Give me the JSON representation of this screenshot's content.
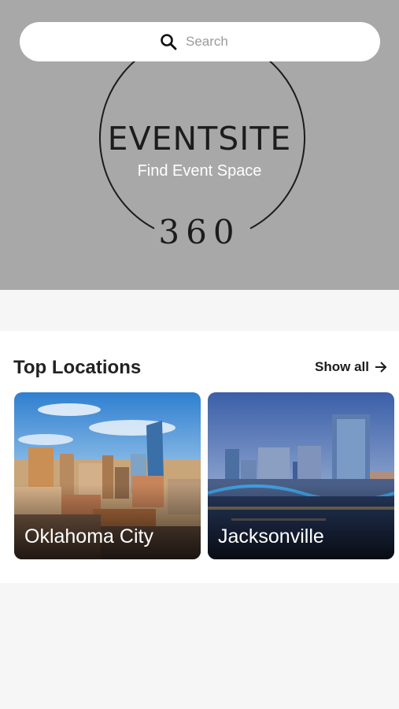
{
  "search": {
    "placeholder": "Search",
    "icon": "search-icon"
  },
  "logo": {
    "title": "EVENTSITE",
    "subtitle": "Find Event Space",
    "number": "360"
  },
  "top_locations": {
    "title": "Top Locations",
    "show_all_label": "Show all",
    "locations": [
      {
        "name": "Oklahoma City"
      },
      {
        "name": "Jacksonville"
      }
    ]
  },
  "colors": {
    "hero_background": "#a8a8a8",
    "page_background": "#f6f6f6"
  }
}
